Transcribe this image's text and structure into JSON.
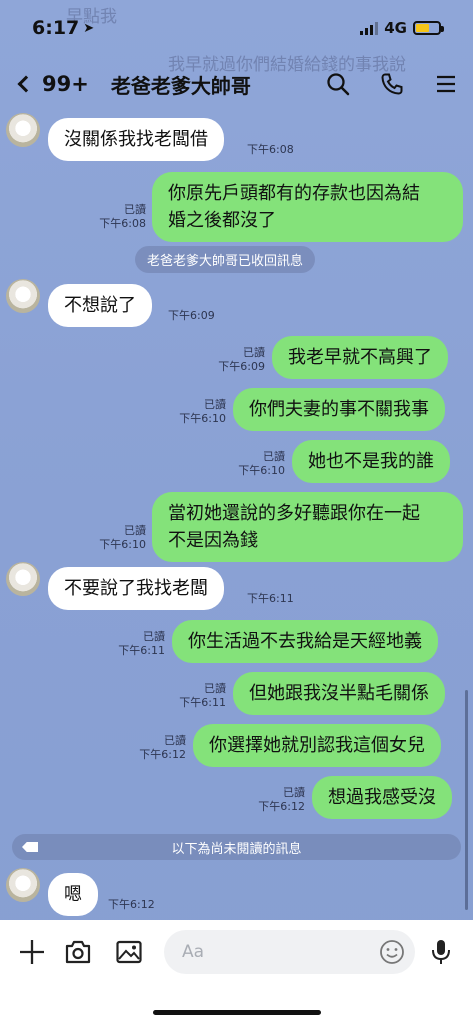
{
  "status_bar": {
    "time": "6:17",
    "network": "4G"
  },
  "ghost": {
    "top_left": "早點我",
    "top_right": "我早就過你們結婚給錢的事我說"
  },
  "header": {
    "back_label": "99+",
    "title": "老爸老爹大帥哥"
  },
  "messages": [
    {
      "id": "m1",
      "side": "left",
      "text": "沒關係我找老闆借",
      "time": "下午6:08"
    },
    {
      "id": "m2",
      "side": "right",
      "lines": [
        "你原先戶頭都有的存款也因為結",
        "婚之後都沒了"
      ],
      "read": "已讀",
      "time": "下午6:08"
    },
    {
      "id": "m4",
      "side": "left",
      "text": "不想說了",
      "time": "下午6:09"
    },
    {
      "id": "m5",
      "side": "right",
      "text": "我老早就不高興了",
      "read": "已讀",
      "time": "下午6:09"
    },
    {
      "id": "m6",
      "side": "right",
      "text": "你們夫妻的事不關我事",
      "read": "已讀",
      "time": "下午6:10"
    },
    {
      "id": "m7",
      "side": "right",
      "text": "她也不是我的誰",
      "read": "已讀",
      "time": "下午6:10"
    },
    {
      "id": "m8",
      "side": "right",
      "lines": [
        "當初她還說的多好聽跟你在一起",
        "不是因為錢"
      ],
      "read": "已讀",
      "time": "下午6:10"
    },
    {
      "id": "m9",
      "side": "left",
      "text": "不要說了我找老闆",
      "time": "下午6:11"
    },
    {
      "id": "m10",
      "side": "right",
      "text": "你生活過不去我給是天經地義",
      "read": "已讀",
      "time": "下午6:11"
    },
    {
      "id": "m11",
      "side": "right",
      "text": "但她跟我沒半點毛關係",
      "read": "已讀",
      "time": "下午6:11"
    },
    {
      "id": "m12",
      "side": "right",
      "text": "你選擇她就別認我這個女兒",
      "read": "已讀",
      "time": "下午6:12"
    },
    {
      "id": "m13",
      "side": "right",
      "text": "想過我感受沒",
      "read": "已讀",
      "time": "下午6:12"
    },
    {
      "id": "m14",
      "side": "left",
      "text": "嗯",
      "time": "下午6:12"
    }
  ],
  "system_message": "老爸老爹大帥哥已收回訊息",
  "unread_divider": "以下為尚未閱讀的訊息",
  "input": {
    "placeholder": "Aa"
  },
  "colors": {
    "background": "#8ca3d6",
    "sent_bubble": "#84e27a",
    "received_bubble": "#ffffff"
  },
  "icons": [
    "search-icon",
    "phone-icon",
    "menu-icon",
    "plus-icon",
    "camera-icon",
    "image-icon",
    "emoji-icon",
    "microphone-icon"
  ]
}
